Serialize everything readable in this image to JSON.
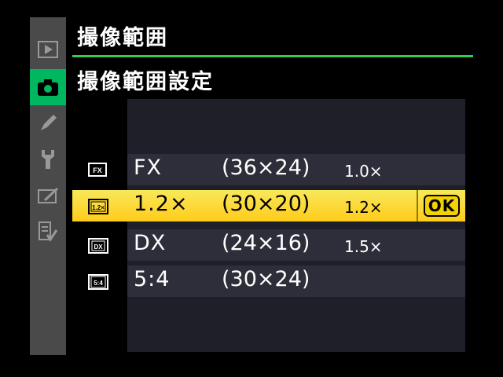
{
  "header": {
    "title": "撮像範囲",
    "subtitle": "撮像範囲設定"
  },
  "sidebar": {
    "items": [
      {
        "icon": "playback-icon",
        "active": false
      },
      {
        "icon": "camera-icon",
        "active": true
      },
      {
        "icon": "pencil-icon",
        "active": false
      },
      {
        "icon": "wrench-icon",
        "active": false
      },
      {
        "icon": "retouch-icon",
        "active": false
      },
      {
        "icon": "my-menu-icon",
        "active": false
      }
    ]
  },
  "menu": {
    "options": [
      {
        "icon_label": "FX",
        "name": "FX",
        "size": "(36×24)",
        "ratio": "1.0×",
        "selected": false
      },
      {
        "icon_label": "1.2×",
        "name": "1.2×",
        "size": "(30×20)",
        "ratio": "1.2×",
        "selected": true
      },
      {
        "icon_label": "DX",
        "name": "DX",
        "size": "(24×16)",
        "ratio": "1.5×",
        "selected": false
      },
      {
        "icon_label": "5:4",
        "name": "5:4",
        "size": "(30×24)",
        "ratio": "",
        "selected": false
      }
    ],
    "ok_label": "OK"
  },
  "colors": {
    "accent_green": "#33cc55",
    "active_tab": "#00b65e",
    "selection": "#ffcc1a"
  }
}
